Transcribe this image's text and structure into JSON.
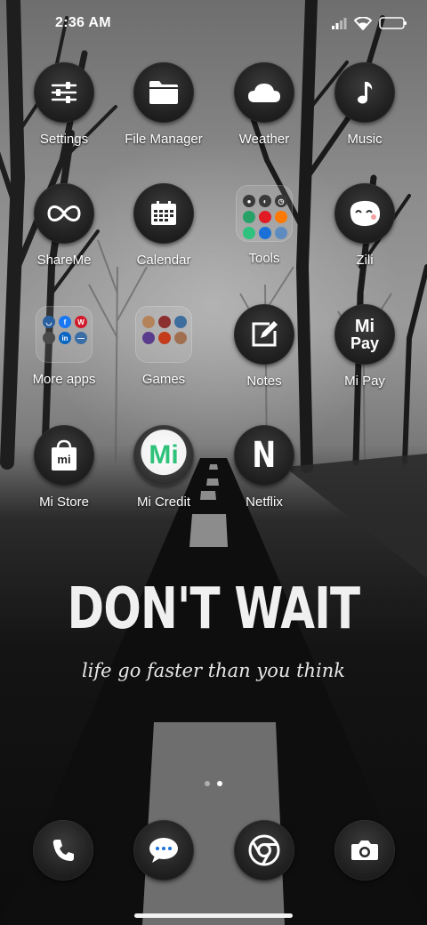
{
  "status_bar": {
    "time": "2:36 AM"
  },
  "apps": [
    {
      "label": "Settings",
      "icon": "sliders-icon"
    },
    {
      "label": "File Manager",
      "icon": "folder-icon"
    },
    {
      "label": "Weather",
      "icon": "cloud-icon"
    },
    {
      "label": "Music",
      "icon": "music-note-icon"
    },
    {
      "label": "ShareMe",
      "icon": "infinity-icon"
    },
    {
      "label": "Calendar",
      "icon": "calendar-icon"
    },
    {
      "label": "Tools",
      "icon": "folder-tools"
    },
    {
      "label": "Zili",
      "icon": "zili-face-icon"
    },
    {
      "label": "More apps",
      "icon": "folder-more-apps"
    },
    {
      "label": "Games",
      "icon": "folder-games"
    },
    {
      "label": "Notes",
      "icon": "notes-edit-icon"
    },
    {
      "label": "Mi Pay",
      "icon": "mi-pay-icon",
      "icon_text_top": "Mi",
      "icon_text_bottom": "Pay"
    },
    {
      "label": "Mi Store",
      "icon": "shopping-bag-icon",
      "icon_text": "mi"
    },
    {
      "label": "Mi Credit",
      "icon": "mi-credit-icon",
      "icon_text": "Mi"
    },
    {
      "label": "Netflix",
      "icon": "netflix-icon",
      "icon_text": "N"
    }
  ],
  "wallpaper": {
    "title": "DON'T WAIT",
    "subtitle": "life go faster than you think"
  },
  "page_indicator": {
    "pages": 2,
    "active": 2
  },
  "dock": [
    {
      "name": "Phone",
      "icon": "phone-icon"
    },
    {
      "name": "Messages",
      "icon": "message-bubble-icon"
    },
    {
      "name": "Chrome",
      "icon": "chrome-icon"
    },
    {
      "name": "Camera",
      "icon": "camera-icon"
    }
  ],
  "colors": {
    "mi_credit_green": "#2fc27a",
    "mi_orange": "#ff6900"
  }
}
